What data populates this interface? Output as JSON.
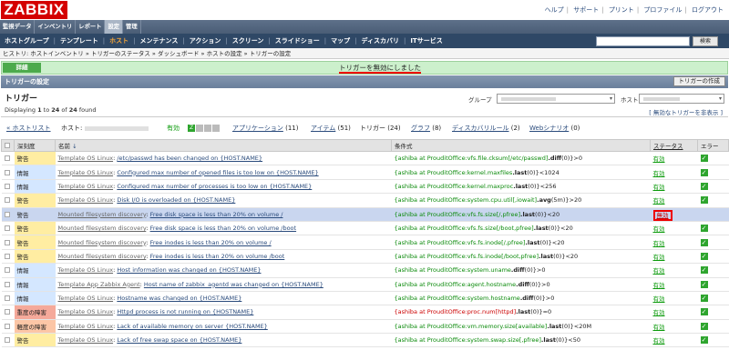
{
  "header": {
    "logo": "ZABBIX",
    "links": [
      "ヘルプ",
      "サポート",
      "プリント",
      "プロファイル",
      "ログアウト"
    ]
  },
  "menu1": [
    "監視データ",
    "インベントリ",
    "レポート",
    "設定",
    "管理"
  ],
  "menu2": [
    "ホストグループ",
    "テンプレート",
    "ホスト",
    "メンテナンス",
    "アクション",
    "スクリーン",
    "スライドショー",
    "マップ",
    "ディスカバリ",
    "ITサービス"
  ],
  "search": {
    "button": "検索"
  },
  "history": "ヒストリ: ホストインベントリ » トリガーのステータス » ダッシュボード » ホストの設定 » トリガーの設定",
  "message": {
    "label": "詳細",
    "text": "トリガーを無効にしました"
  },
  "section": {
    "title": "トリガーの設定",
    "create_button": "トリガーの作成"
  },
  "page": {
    "title": "トリガー",
    "displaying": {
      "prefix": "Displaying ",
      "from": "1",
      "mid1": " to ",
      "to": "24",
      "mid2": " of ",
      "total": "24",
      "suffix": " found"
    },
    "group_label": "グループ",
    "host_label": "ホスト",
    "disabled_link": "[ 無効なトリガーを非表示 ]"
  },
  "hostnav": {
    "back": "« ホストリスト",
    "host_label": "ホスト:",
    "status": "有効",
    "badge": "Z",
    "links": [
      {
        "label": "アプリケーション",
        "count": "(11)"
      },
      {
        "label": "アイテム",
        "count": "(51)"
      },
      {
        "label": "トリガー",
        "count": "(24)",
        "current": true
      },
      {
        "label": "グラフ",
        "count": "(8)"
      },
      {
        "label": "ディスカバリルール",
        "count": "(2)"
      },
      {
        "label": "Webシナリオ",
        "count": "(0)"
      }
    ]
  },
  "table": {
    "headers": {
      "severity": "深刻度",
      "name": "名前",
      "expression": "条件式",
      "status": "ステータス",
      "error": "エラー"
    },
    "rows": [
      {
        "severity": "警告",
        "sev": "warn",
        "prefix": "Template OS Linux",
        "name": "/etc/passwd has been changed on {HOST.NAME}",
        "host": "{ashiba at ProuditOffice:vfs.file.cksum[/etc/passwd]",
        "func": ".diff",
        "tail": "(0)}>0",
        "status": "有効",
        "error": true
      },
      {
        "severity": "情報",
        "sev": "info",
        "prefix": "Template OS Linux",
        "name": "Configured max number of opened files is too low on {HOST.NAME}",
        "host": "{ashiba at ProuditOffice:kernel.maxfiles",
        "func": ".last",
        "tail": "(0)}<1024",
        "status": "有効",
        "error": true
      },
      {
        "severity": "情報",
        "sev": "info",
        "prefix": "Template OS Linux",
        "name": "Configured max number of processes is too low on {HOST.NAME}",
        "host": "{ashiba at ProuditOffice:kernel.maxproc",
        "func": ".last",
        "tail": "(0)}<256",
        "status": "有効",
        "error": true
      },
      {
        "severity": "警告",
        "sev": "warn",
        "prefix": "Template OS Linux",
        "name": "Disk I/O is overloaded on {HOST.NAME}",
        "host": "{ashiba at ProuditOffice:system.cpu.util[,iowait]",
        "func": ".avg",
        "tail": "(5m)}>20",
        "status": "有効",
        "error": true
      },
      {
        "severity": "警告",
        "sev": "warn",
        "prefix": "Mounted filesystem discovery",
        "name": "Free disk space is less than 20% on volume /",
        "host": "{ashiba at ProuditOffice:vfs.fs.size[/,pfree]",
        "func": ".last",
        "tail": "(0)}<20",
        "status": "無効",
        "disabled": true,
        "highlight": true,
        "error": false
      },
      {
        "severity": "警告",
        "sev": "warn",
        "prefix": "Mounted filesystem discovery",
        "name": "Free disk space is less than 20% on volume /boot",
        "host": "{ashiba at ProuditOffice:vfs.fs.size[/boot,pfree]",
        "func": ".last",
        "tail": "(0)}<20",
        "status": "有効",
        "error": true
      },
      {
        "severity": "警告",
        "sev": "warn",
        "prefix": "Mounted filesystem discovery",
        "name": "Free inodes is less than 20% on volume /",
        "host": "{ashiba at ProuditOffice:vfs.fs.inode[/,pfree]",
        "func": ".last",
        "tail": "(0)}<20",
        "status": "有効",
        "error": true
      },
      {
        "severity": "警告",
        "sev": "warn",
        "prefix": "Mounted filesystem discovery",
        "name": "Free inodes is less than 20% on volume /boot",
        "host": "{ashiba at ProuditOffice:vfs.fs.inode[/boot,pfree]",
        "func": ".last",
        "tail": "(0)}<20",
        "status": "有効",
        "error": true
      },
      {
        "severity": "情報",
        "sev": "info",
        "prefix": "Template OS Linux",
        "name": "Host information was changed on {HOST.NAME}",
        "host": "{ashiba at ProuditOffice:system.uname",
        "func": ".diff",
        "tail": "(0)}>0",
        "status": "有効",
        "error": true
      },
      {
        "severity": "情報",
        "sev": "info",
        "prefix": "Template App Zabbix Agent",
        "name": "Host name of zabbix_agentd was changed on {HOST.NAME}",
        "host": "{ashiba at ProuditOffice:agent.hostname",
        "func": ".diff",
        "tail": "(0)}>0",
        "status": "有効",
        "error": true
      },
      {
        "severity": "情報",
        "sev": "info",
        "prefix": "Template OS Linux",
        "name": "Hostname was changed on {HOST.NAME}",
        "host": "{ashiba at ProuditOffice:system.hostname",
        "func": ".diff",
        "tail": "(0)}>0",
        "status": "有効",
        "error": true
      },
      {
        "severity": "重度の障害",
        "sev": "high",
        "prefix": "Template OS Linux",
        "name": "Httpd process is not running on {HOSTNAME}",
        "host": "{ashiba at ProuditOffice:proc.num[httpd]",
        "func": ".last",
        "tail": "(0)}=0",
        "red": true,
        "status": "有効",
        "error": true
      },
      {
        "severity": "軽度の障害",
        "sev": "avg",
        "prefix": "Template OS Linux",
        "name": "Lack of available memory on server {HOST.NAME}",
        "host": "{ashiba at ProuditOffice:vm.memory.size[available]",
        "func": ".last",
        "tail": "(0)}<20M",
        "status": "有効",
        "error": true
      },
      {
        "severity": "警告",
        "sev": "warn",
        "prefix": "Template OS Linux",
        "name": "Lack of free swap space on {HOST.NAME}",
        "host": "{ashiba at ProuditOffice:system.swap.size[,pfree]",
        "func": ".last",
        "tail": "(0)}<50",
        "status": "有効",
        "error": true
      }
    ]
  }
}
